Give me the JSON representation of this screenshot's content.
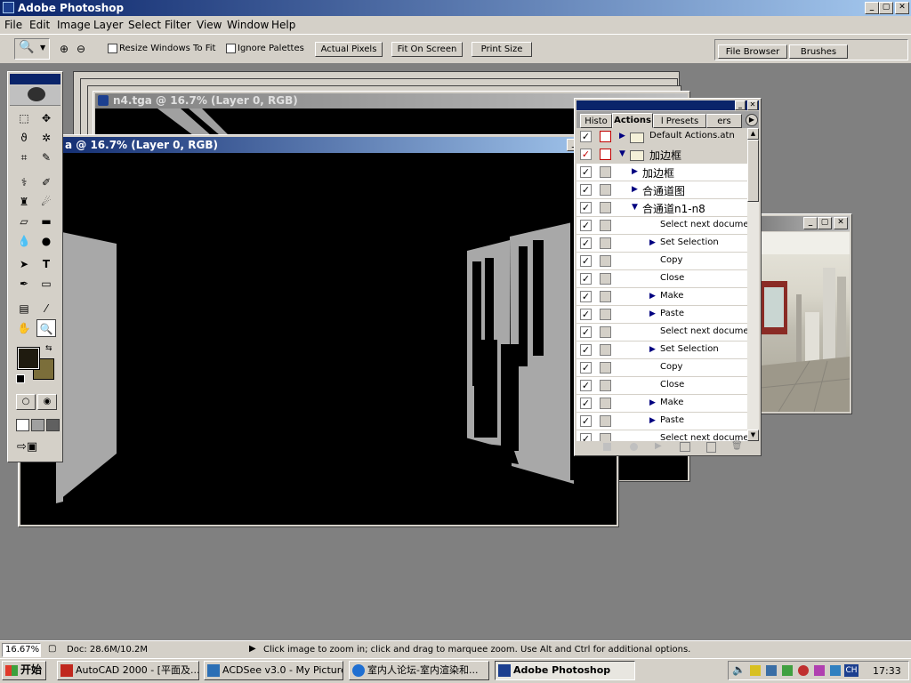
{
  "app": {
    "title": "Adobe Photoshop",
    "window_buttons": [
      "_",
      "▢",
      "✕"
    ]
  },
  "menu": [
    "File",
    "Edit",
    "Image",
    "Layer",
    "Select",
    "Filter",
    "View",
    "Window",
    "Help"
  ],
  "options_bar": {
    "resize_windows_label": "Resize Windows To Fit",
    "ignore_palettes_label": "Ignore Palettes",
    "actual_pixels": "Actual Pixels",
    "fit_on_screen": "Fit On Screen",
    "print_size": "Print Size",
    "well_tabs": [
      "File Browser",
      "Brushes"
    ]
  },
  "documents": {
    "back_doc_title": "n4.tga @ 16.7% (Layer 0, RGB)",
    "front_doc_title": "a @ 16.7% (Layer 0, RGB)"
  },
  "actions_palette": {
    "tabs": [
      "Histo",
      "Actions",
      "l Presets",
      "ers"
    ],
    "rows": [
      {
        "label": "Default Actions.atn",
        "level": 0,
        "tri": "▶",
        "folder": true
      },
      {
        "label": "加边框",
        "level": 0,
        "tri": "▼",
        "folder": true
      },
      {
        "label": "加边框",
        "level": 1,
        "tri": "▶"
      },
      {
        "label": "合通道图",
        "level": 1,
        "tri": "▶"
      },
      {
        "label": "合通道n1-n8",
        "level": 1,
        "tri": "▼"
      },
      {
        "label": "Select next docume...",
        "level": 2,
        "tri": ""
      },
      {
        "label": "Set Selection",
        "level": 2,
        "tri": "▶"
      },
      {
        "label": "Copy",
        "level": 2,
        "tri": ""
      },
      {
        "label": "Close",
        "level": 2,
        "tri": ""
      },
      {
        "label": "Make",
        "level": 2,
        "tri": "▶"
      },
      {
        "label": "Paste",
        "level": 2,
        "tri": "▶"
      },
      {
        "label": "Select next docume...",
        "level": 2,
        "tri": ""
      },
      {
        "label": "Set Selection",
        "level": 2,
        "tri": "▶"
      },
      {
        "label": "Copy",
        "level": 2,
        "tri": ""
      },
      {
        "label": "Close",
        "level": 2,
        "tri": ""
      },
      {
        "label": "Make",
        "level": 2,
        "tri": "▶"
      },
      {
        "label": "Paste",
        "level": 2,
        "tri": "▶"
      },
      {
        "label": "Select next docume...",
        "level": 2,
        "tri": ""
      }
    ]
  },
  "status_bar": {
    "zoom": "16.67%",
    "doc_info": "Doc: 28.6M/10.2M",
    "hint": "Click image to zoom in; click and drag to marquee zoom.  Use Alt and Ctrl for additional options."
  },
  "taskbar": {
    "start": "开始",
    "tasks": [
      "AutoCAD 2000 - [平面及...",
      "ACDSee v3.0 - My Pictures",
      "室内人论坛-室内渲染和...",
      "Adobe Photoshop"
    ],
    "clock": "17:33",
    "lang": "CH"
  },
  "colors": {
    "foreground": "#1f1b0f",
    "background": "#7b6e3a",
    "title_active": "#0a246a"
  }
}
